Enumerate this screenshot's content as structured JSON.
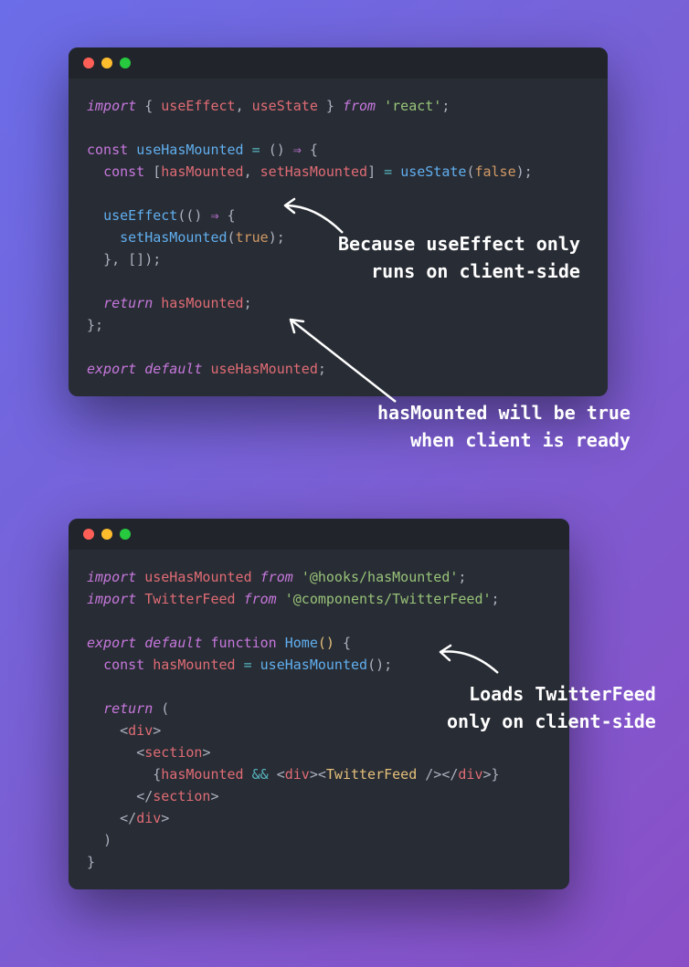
{
  "window1": {
    "code_html": "<span class=\"t-kw\">import</span> <span class=\"t-pun\">{</span> <span class=\"t-var\">useEffect</span><span class=\"t-pun\">,</span> <span class=\"t-var\">useState</span> <span class=\"t-pun\">}</span> <span class=\"t-kw\">from</span> <span class=\"t-str\">'react'</span><span class=\"t-pun\">;</span>\n\n<span class=\"t-kw2\">const</span> <span class=\"t-fn\">useHasMounted</span> <span class=\"t-op\">=</span> <span class=\"t-pun\">()</span> <span class=\"t-kw2\">⇒</span> <span class=\"t-pun\">{</span>\n  <span class=\"t-kw2\">const</span> <span class=\"t-pun\">[</span><span class=\"t-var\">hasMounted</span><span class=\"t-pun\">,</span> <span class=\"t-var\">setHasMounted</span><span class=\"t-pun\">]</span> <span class=\"t-op\">=</span> <span class=\"t-fn\">useState</span><span class=\"t-pun\">(</span><span class=\"t-bool\">false</span><span class=\"t-pun\">);</span>\n\n  <span class=\"t-fn\">useEffect</span><span class=\"t-pun\">(()</span> <span class=\"t-kw2\">⇒</span> <span class=\"t-pun\">{</span>\n    <span class=\"t-fn\">setHasMounted</span><span class=\"t-pun\">(</span><span class=\"t-bool\">true</span><span class=\"t-pun\">);</span>\n  <span class=\"t-pun\">}, []);</span>\n\n  <span class=\"t-kw\">return</span> <span class=\"t-var\">hasMounted</span><span class=\"t-pun\">;</span>\n<span class=\"t-pun\">};</span>\n\n<span class=\"t-kw\">export</span> <span class=\"t-kw\">default</span> <span class=\"t-var\">useHasMounted</span><span class=\"t-pun\">;</span>"
  },
  "window2": {
    "code_html": "<span class=\"t-kw\">import</span> <span class=\"t-var\">useHasMounted</span> <span class=\"t-kw\">from</span> <span class=\"t-str\">'@hooks/hasMounted'</span><span class=\"t-pun\">;</span>\n<span class=\"t-kw\">import</span> <span class=\"t-var\">TwitterFeed</span> <span class=\"t-kw\">from</span> <span class=\"t-str\">'@components/TwitterFeed'</span><span class=\"t-pun\">;</span>\n\n<span class=\"t-kw\">export</span> <span class=\"t-kw\">default</span> <span class=\"t-kw2\">function</span> <span class=\"t-fn\">Home</span><span class=\"t-id\">()</span> <span class=\"t-pun\">{</span>\n  <span class=\"t-kw2\">const</span> <span class=\"t-var\">hasMounted</span> <span class=\"t-op\">=</span> <span class=\"t-fn\">useHasMounted</span><span class=\"t-pun\">();</span>\n\n  <span class=\"t-kw\">return</span> <span class=\"t-pun\">(</span>\n    <span class=\"t-pun\">&lt;</span><span class=\"t-tag\">div</span><span class=\"t-pun\">&gt;</span>\n      <span class=\"t-pun\">&lt;</span><span class=\"t-tag\">section</span><span class=\"t-pun\">&gt;</span>\n        <span class=\"t-pun\">{</span><span class=\"t-var\">hasMounted</span> <span class=\"t-op\">&amp;&amp;</span> <span class=\"t-pun\">&lt;</span><span class=\"t-tag\">div</span><span class=\"t-pun\">&gt;&lt;</span><span class=\"t-comp\">TwitterFeed</span> <span class=\"t-pun\">/&gt;&lt;/</span><span class=\"t-tag\">div</span><span class=\"t-pun\">&gt;}</span>\n      <span class=\"t-pun\">&lt;/</span><span class=\"t-tag\">section</span><span class=\"t-pun\">&gt;</span>\n    <span class=\"t-pun\">&lt;/</span><span class=\"t-tag\">div</span><span class=\"t-pun\">&gt;</span>\n  <span class=\"t-pun\">)</span>\n<span class=\"t-pun\">}</span>"
  },
  "annotations": {
    "a1_line1": "Because useEffect only",
    "a1_line2": "runs on client-side",
    "a2_line1": "hasMounted will be true",
    "a2_line2": "when client is ready",
    "a3_line1": "Loads TwitterFeed",
    "a3_line2": "only on client-side"
  }
}
